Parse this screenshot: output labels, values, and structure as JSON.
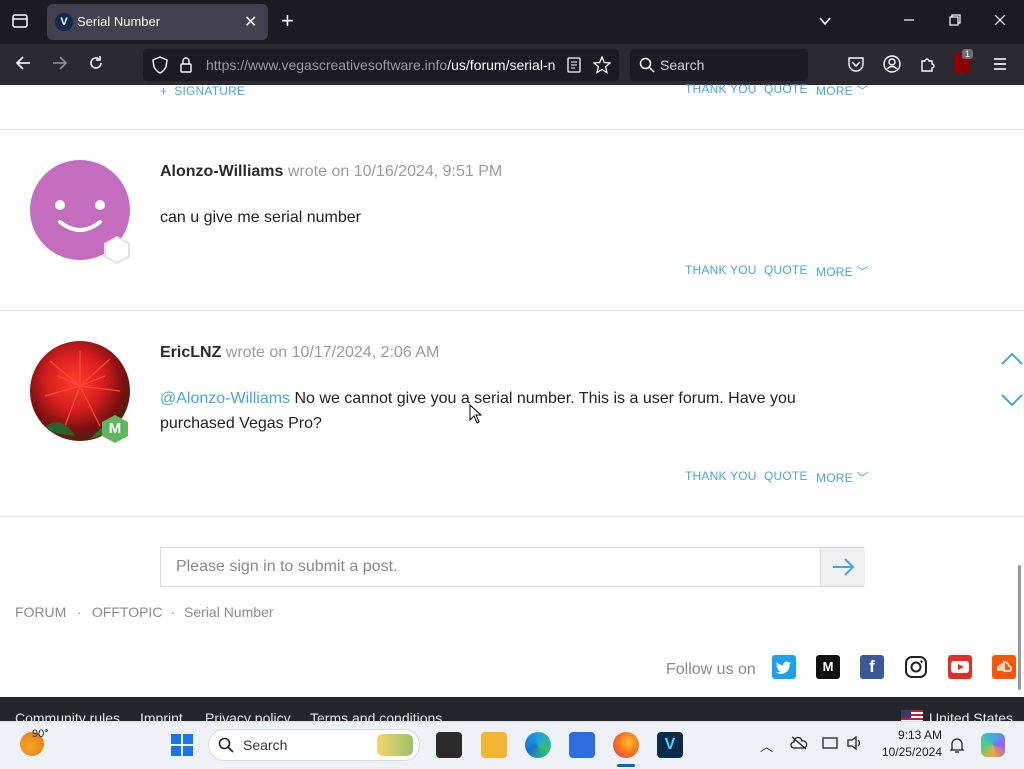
{
  "browser": {
    "tab_title": "Serial Number",
    "tab_favicon_letter": "V",
    "url_host": "https://www.vegascreativesoftware.info",
    "url_path": "/us/forum/serial-n",
    "search_placeholder": "Search",
    "extension_badge": "1"
  },
  "top_post_actions": {
    "signature": "SIGNATURE",
    "thank": "THANK YOU",
    "quote": "QUOTE",
    "more": "MORE"
  },
  "posts": [
    {
      "author": "Alonzo-Williams",
      "meta": "wrote on 10/16/2024, 9:51 PM",
      "text": "can u give me serial number",
      "thank": "THANK YOU",
      "quote": "QUOTE",
      "more": "MORE"
    },
    {
      "author": "EricLNZ",
      "meta": "wrote on 10/17/2024, 2:06 AM",
      "mention": "@Alonzo-Williams",
      "text": " No we cannot give you a serial number. This is a user forum. Have you purchased Vegas Pro?",
      "badge": "M",
      "thank": "THANK YOU",
      "quote": "QUOTE",
      "more": "MORE"
    }
  ],
  "reply": {
    "placeholder": "Please sign in to submit a post."
  },
  "breadcrumb": {
    "items": [
      "FORUM",
      "OFFTOPIC",
      "Serial Number"
    ],
    "separator": "·"
  },
  "follow": {
    "label": "Follow us on",
    "networks": [
      "twitter",
      "medium",
      "facebook",
      "instagram",
      "youtube",
      "soundcloud"
    ]
  },
  "footer": {
    "links": [
      "Community rules",
      "Imprint",
      "Privacy policy",
      "Terms and conditions"
    ],
    "country": "United States"
  },
  "taskbar": {
    "weather_temp": "90°",
    "search_label": "Search",
    "time": "9:13 AM",
    "date": "10/25/2024"
  },
  "colors": {
    "link": "#4aa3df",
    "avatar_pink": "#c46cbd",
    "badge_green": "#5cb85c"
  }
}
